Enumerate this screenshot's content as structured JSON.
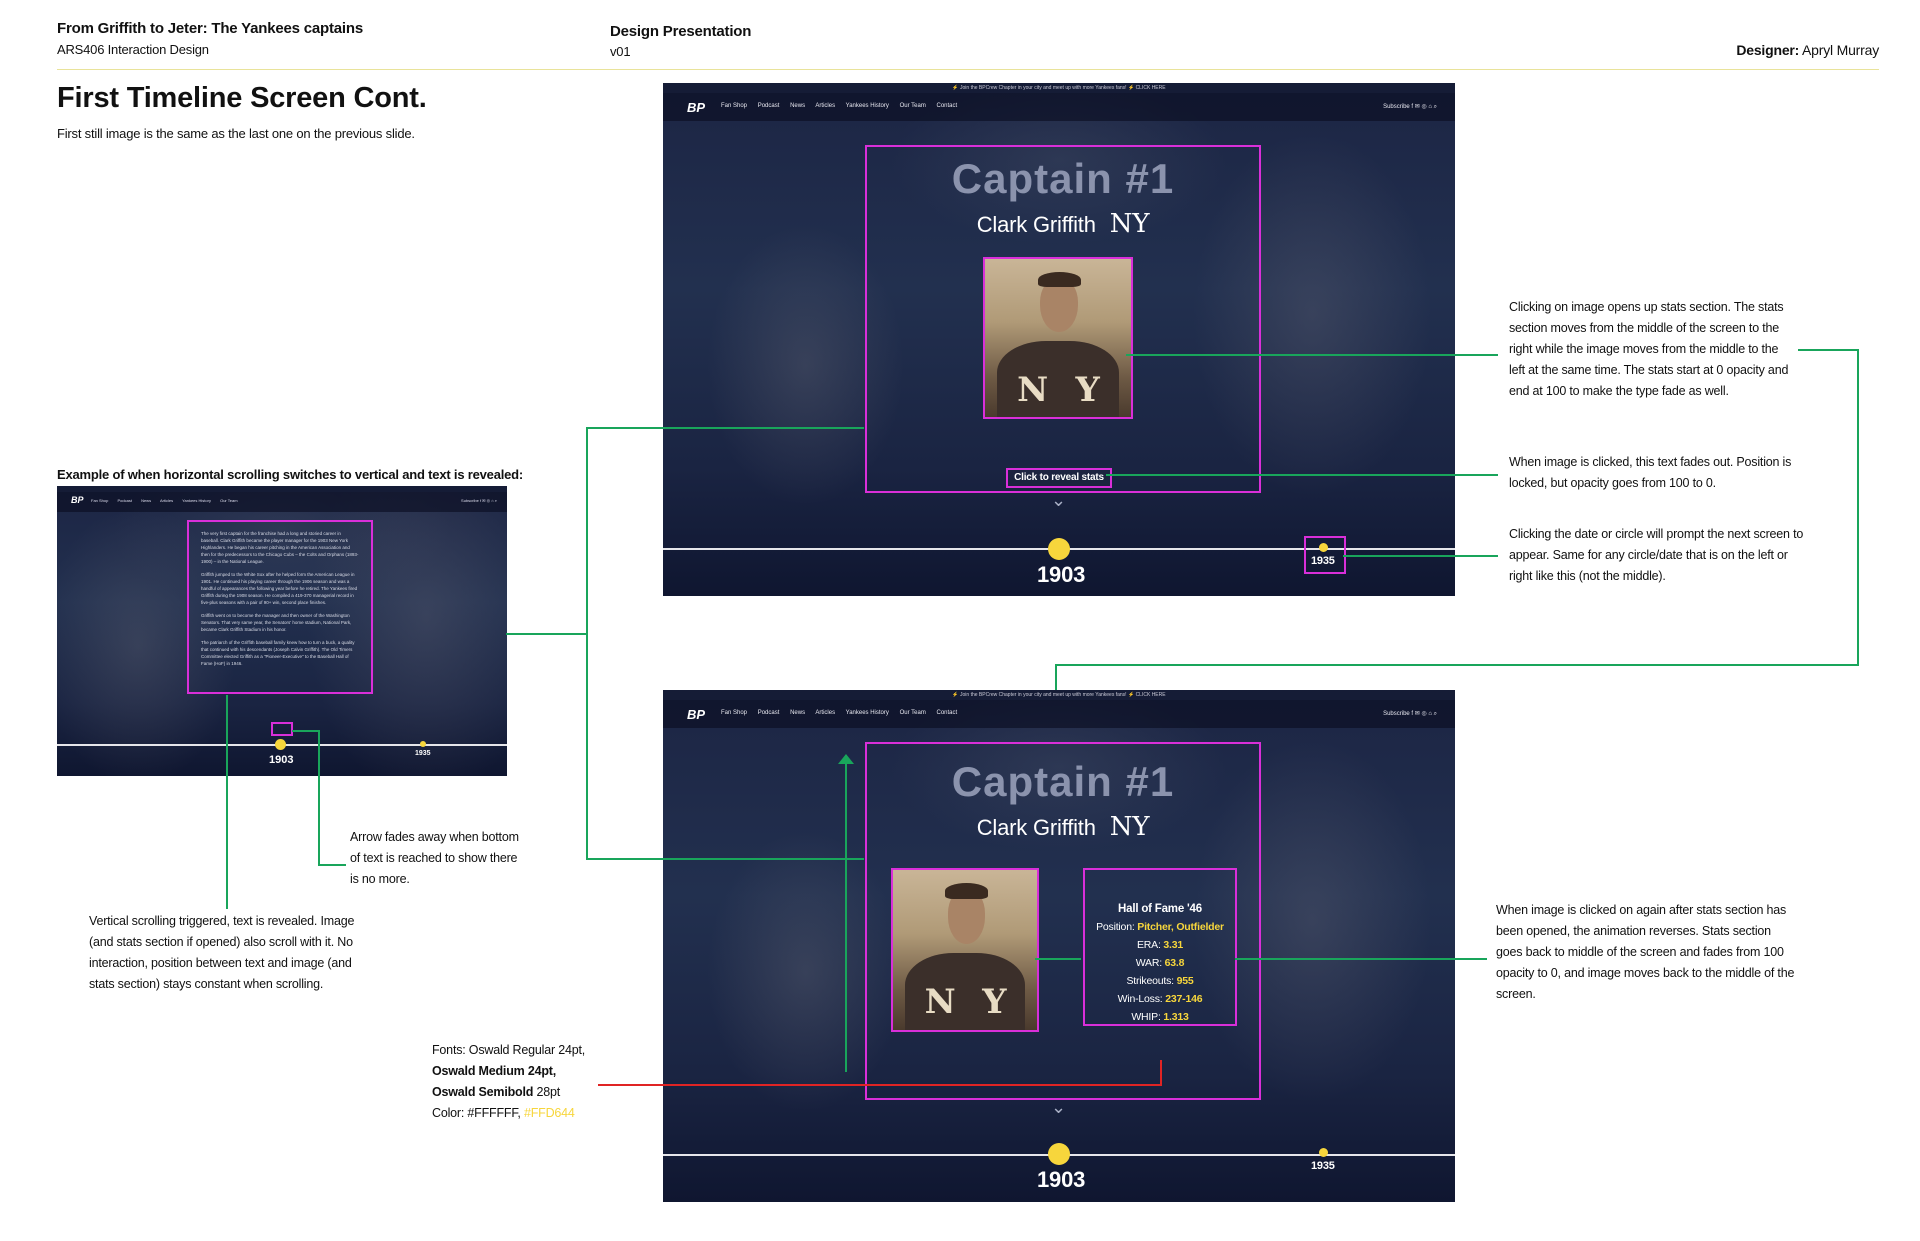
{
  "header": {
    "project_title": "From Griffith to Jeter: The Yankees captains",
    "course": "ARS406 Interaction Design",
    "doc_type": "Design Presentation",
    "version": "v01",
    "designer_label": "Designer:",
    "designer_name": "Apryl Murray"
  },
  "page": {
    "title": "First Timeline Screen Cont.",
    "subtitle": "First still image is the same as the last one on the previous slide."
  },
  "example": {
    "caption": "Example of when horizontal scrolling switches to vertical and text is revealed:",
    "paragraphs": [
      "The very first captain for the franchise had a long and storied career in baseball. Clark Griffith became the player manager for the 1903 New York Highlanders. He began his career pitching in the American Association and then for the predecessors to the Chicago Cubs – the Colts and Orphans (1893-1900) – in the National League.",
      "Griffith jumped to the White Sox after he helped form the American League in 1901. He continued his playing career through the 1906 season and was a handful of appearances the following year before he retired. The Yankees fired Griffith during the 1908 season. He compiled a 419-370 managerial record in five-plus seasons with a pair of 90+ win, second place finishes.",
      "Griffith went on to become the manager and then owner of the Washington Senators. That very same year, the Senators' home stadium, National Park, became Clark Griffith Stadium in his honor.",
      "The patriarch of the Griffith baseball family knew how to turn a buck, a quality that continued with his descendants (Joseph Calvin Griffith). The Old Timers Committee elected Griffith as a \"Pioneer-Executive\" to the Baseball Hall of Fame (HoF) in 1946."
    ]
  },
  "mock": {
    "banner": "⚡ Join the BPCrew Chapter in your city and meet up with more Yankees fans! ⚡ CLICK HERE",
    "logo": "BP",
    "nav": [
      "Fan Shop",
      "Podcast",
      "News",
      "Articles",
      "Yankees History",
      "Our Team",
      "Contact"
    ],
    "nav_right": "Subscribe  f  ✉  ◎  ⌂  ⌕",
    "captain_title": "Captain #1",
    "player_name": "Clark Griffith",
    "team_mark": "NY",
    "jersey_n": "N",
    "jersey_y": "Y",
    "reveal_button": "Click to reveal stats",
    "chevron": "⌄",
    "year_current": "1903",
    "year_next": "1935"
  },
  "stats": {
    "heading": "Hall of Fame '46",
    "rows": [
      {
        "label": "Position:",
        "value": "Pitcher, Outfielder"
      },
      {
        "label": "ERA:",
        "value": "3.31"
      },
      {
        "label": "WAR:",
        "value": "63.8"
      },
      {
        "label": "Strikeouts:",
        "value": "955"
      },
      {
        "label": "Win-Loss:",
        "value": "237-146"
      },
      {
        "label": "WHIP:",
        "value": "1.313"
      }
    ]
  },
  "notes": {
    "image_click": "Clicking on image opens up stats section. The stats section moves from the middle of the screen to the right while the image moves from the middle to the left at the same time. The stats start at 0 opacity and end at 100 to make the type fade as well.",
    "text_fade": "When image is clicked, this text fades out. Position is locked, but opacity goes from 100 to 0.",
    "date_click": "Clicking the date or circle will prompt the next screen to appear. Same for any circle/date that is on the left or right like this (not the middle).",
    "reverse": "When image is clicked on again after stats section has been opened, the animation reverses. Stats section goes back to middle of the screen and fades from 100 opacity to 0, and image moves back to the middle of the screen.",
    "arrow_fade": "Arrow fades away when bottom of text is reached to show there is no more.",
    "vertical_scroll": "Vertical scrolling triggered, text is revealed. Image (and stats section if opened) also scroll with it. No interaction, position between text and image (and stats section) stays constant when scrolling."
  },
  "fonts_note": {
    "line1": "Fonts: Oswald Regular 24pt,",
    "line2": "Oswald Medium 24pt,",
    "line3": "Oswald Semibold",
    "line3_size": " 28pt",
    "color_label": "Color: #FFFFFF,",
    "color_accent": "#FFD644"
  },
  "colors": {
    "accent_yellow": "#F7D63C",
    "highlight_pink": "#D92FD9",
    "connector_green": "#19A55B",
    "connector_red": "#E02424",
    "screen_navy": "#1C2544"
  }
}
